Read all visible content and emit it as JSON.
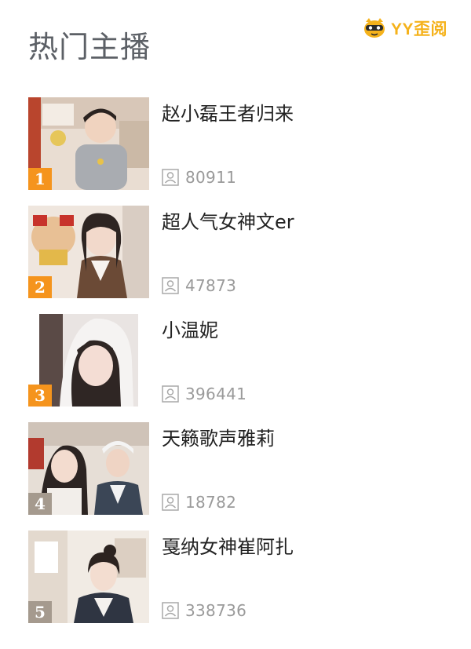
{
  "brand": {
    "logo_text": "YY歪阅",
    "mascot_icon": "yy-mascot-icon",
    "color": "#f5b21b"
  },
  "section": {
    "title": "热门主播"
  },
  "colors": {
    "rank_top3": "#f5941d",
    "rank_other": "#a59a8e",
    "title_text": "#5c6066",
    "name_text": "#222222",
    "count_text": "#9a9a9a"
  },
  "streamers": [
    {
      "rank": "1",
      "name": "赵小磊王者归来",
      "viewers": "80911",
      "viewer_icon": "person-icon"
    },
    {
      "rank": "2",
      "name": "超人气女神文er",
      "viewers": "47873",
      "viewer_icon": "person-icon"
    },
    {
      "rank": "3",
      "name": "小温妮",
      "viewers": "396441",
      "viewer_icon": "person-icon"
    },
    {
      "rank": "4",
      "name": "天籁歌声雅莉",
      "viewers": "18782",
      "viewer_icon": "person-icon"
    },
    {
      "rank": "5",
      "name": "戛纳女神崔阿扎",
      "viewers": "338736",
      "viewer_icon": "person-icon"
    }
  ]
}
